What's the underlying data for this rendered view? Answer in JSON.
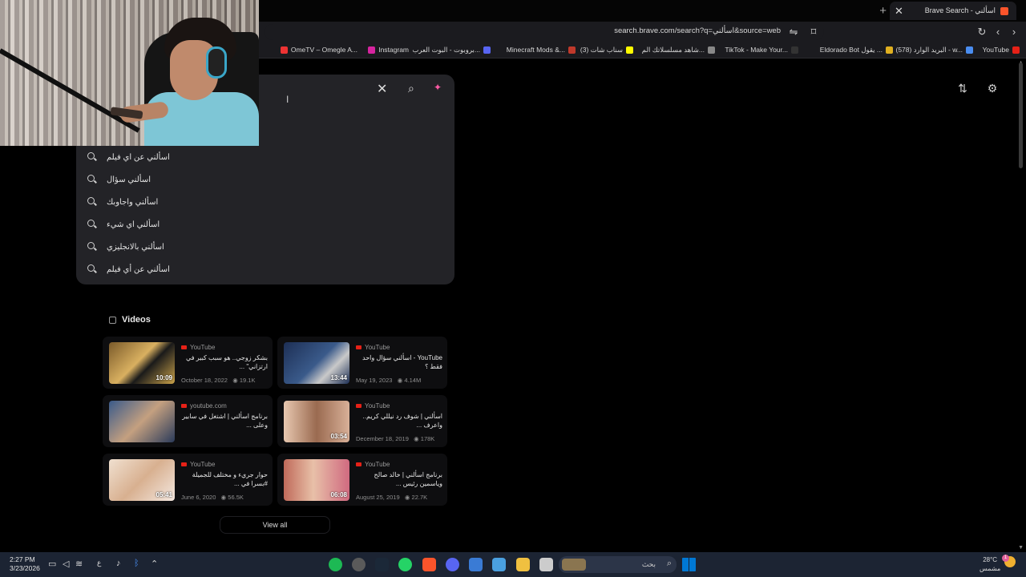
{
  "tab": {
    "title": "Brave Search - اسألني",
    "close": "✕"
  },
  "newtab": "+",
  "address": {
    "url": "search.brave.com/search?q=اسألني&source=web"
  },
  "bookmarks": [
    "YouTube",
    "البريد الوارد (578) - w...",
    "Eldorado Bot يقول ...",
    "TikTok - Make Your...",
    "شاهد مسلسلاتك الم...",
    "سناب شات (3)",
    "Minecraft Mods &...",
    "بروبوت - البوت العرب...",
    "Instagram",
    "OmeTV – Omegle A..."
  ],
  "search": {
    "suggestions": [
      "اسألني عن اي فيلم",
      "اسألني سؤال",
      "اسألني واجاوبك",
      "اسألني اي شيء",
      "اسألني بالانجليزي",
      "اسألني عن أي فيلم"
    ]
  },
  "videos": {
    "heading": "Videos",
    "view_all": "View all",
    "items": [
      {
        "source": "YouTube",
        "title": "بشكر زوجي.. هو سبب كبير في ارتزاني\" ...",
        "date": "October 18, 2022",
        "views": "19.1K",
        "duration": "10:09"
      },
      {
        "source": "YouTube",
        "title": "YouTube - اسألني سؤال واحد فقط ؟",
        "date": "May 19, 2023",
        "views": "4.14M",
        "duration": "13:44"
      },
      {
        "source": "youtube.com",
        "title": "برنامج اسألني | اشتغل في سابير وعلى ...",
        "date": "",
        "views": "",
        "duration": ""
      },
      {
        "source": "YouTube",
        "title": "اسألني | شوف رد نيللي كريم.. واعرف ...",
        "date": "December 18, 2019",
        "views": "178K",
        "duration": "03:54"
      },
      {
        "source": "YouTube",
        "title": "حوار جريء و مختلف للجميلة #بسرا في ...",
        "date": "June 6, 2020",
        "views": "56.5K",
        "duration": "05:41"
      },
      {
        "source": "YouTube",
        "title": "برنامج اسألني | خالد صالح وياسمين رئيس ...",
        "date": "August 25, 2019",
        "views": "22.7K",
        "duration": "06:08"
      }
    ]
  },
  "taskbar": {
    "time": "2:27 PM",
    "date": "3/23/2026",
    "search_label": "بحث",
    "weather_temp": "28°C",
    "weather_desc": "مشمس",
    "lang": "ع",
    "notif_count": "1"
  },
  "colors": {
    "accent": "#fb542b",
    "youtube": "#e62117",
    "taskbar": "#1c2433"
  }
}
